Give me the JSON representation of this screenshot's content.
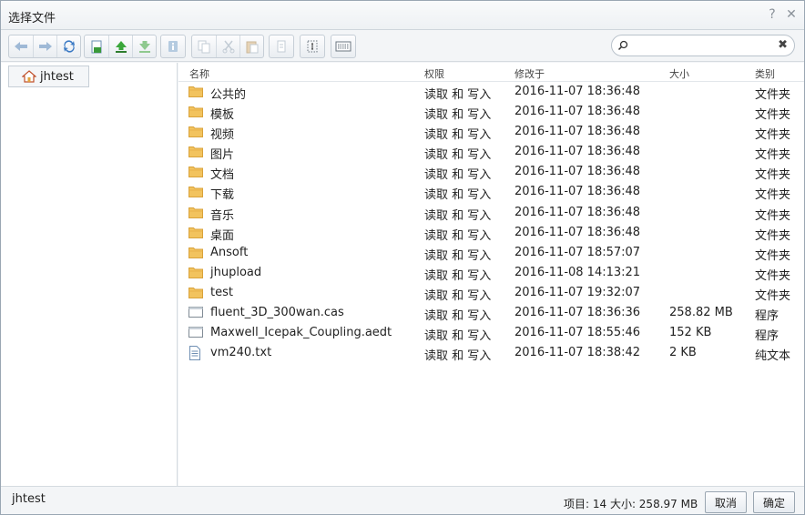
{
  "window": {
    "title": "选择文件"
  },
  "titlebar": {
    "help_glyph": "?",
    "close_glyph": "✕"
  },
  "toolbar": {
    "buttons": [
      "back-icon",
      "forward-icon",
      "refresh-icon",
      "new-folder-icon",
      "upload-icon",
      "download-icon",
      "info-icon",
      "copy-icon",
      "cut-icon",
      "paste-icon",
      "delete-icon",
      "select-icon",
      "view-icon"
    ]
  },
  "search": {
    "value": "",
    "placeholder": "",
    "clear_glyph": "✖"
  },
  "sidebar": {
    "root_label": "jhtest"
  },
  "list": {
    "columns": {
      "name": "名称",
      "perm": "权限",
      "modified": "修改于",
      "size": "大小",
      "type": "类别"
    },
    "rows": [
      {
        "name": "公共的",
        "perm": "读取 和 写入",
        "modified": "2016-11-07 18:36:48",
        "size": "",
        "type": "文件夹",
        "icon": "folder"
      },
      {
        "name": "模板",
        "perm": "读取 和 写入",
        "modified": "2016-11-07 18:36:48",
        "size": "",
        "type": "文件夹",
        "icon": "folder"
      },
      {
        "name": "视频",
        "perm": "读取 和 写入",
        "modified": "2016-11-07 18:36:48",
        "size": "",
        "type": "文件夹",
        "icon": "folder"
      },
      {
        "name": "图片",
        "perm": "读取 和 写入",
        "modified": "2016-11-07 18:36:48",
        "size": "",
        "type": "文件夹",
        "icon": "folder"
      },
      {
        "name": "文档",
        "perm": "读取 和 写入",
        "modified": "2016-11-07 18:36:48",
        "size": "",
        "type": "文件夹",
        "icon": "folder"
      },
      {
        "name": "下载",
        "perm": "读取 和 写入",
        "modified": "2016-11-07 18:36:48",
        "size": "",
        "type": "文件夹",
        "icon": "folder"
      },
      {
        "name": "音乐",
        "perm": "读取 和 写入",
        "modified": "2016-11-07 18:36:48",
        "size": "",
        "type": "文件夹",
        "icon": "folder"
      },
      {
        "name": "桌面",
        "perm": "读取 和 写入",
        "modified": "2016-11-07 18:36:48",
        "size": "",
        "type": "文件夹",
        "icon": "folder"
      },
      {
        "name": "Ansoft",
        "perm": "读取 和 写入",
        "modified": "2016-11-07 18:57:07",
        "size": "",
        "type": "文件夹",
        "icon": "folder"
      },
      {
        "name": "jhupload",
        "perm": "读取 和 写入",
        "modified": "2016-11-08 14:13:21",
        "size": "",
        "type": "文件夹",
        "icon": "folder"
      },
      {
        "name": "test",
        "perm": "读取 和 写入",
        "modified": "2016-11-07 19:32:07",
        "size": "",
        "type": "文件夹",
        "icon": "folder"
      },
      {
        "name": "fluent_3D_300wan.cas",
        "perm": "读取 和 写入",
        "modified": "2016-11-07 18:36:36",
        "size": "258.82 MB",
        "type": "程序",
        "icon": "program"
      },
      {
        "name": "Maxwell_Icepak_Coupling.aedt",
        "perm": "读取 和 写入",
        "modified": "2016-11-07 18:55:46",
        "size": "152 KB",
        "type": "程序",
        "icon": "program"
      },
      {
        "name": "vm240.txt",
        "perm": "读取 和 写入",
        "modified": "2016-11-07 18:38:42",
        "size": "2 KB",
        "type": "纯文本",
        "icon": "text-file"
      }
    ]
  },
  "status": {
    "path": "jhtest",
    "summary": "项目: 14 大小: 258.97 MB",
    "cancel_label": "取消",
    "ok_label": "确定"
  }
}
